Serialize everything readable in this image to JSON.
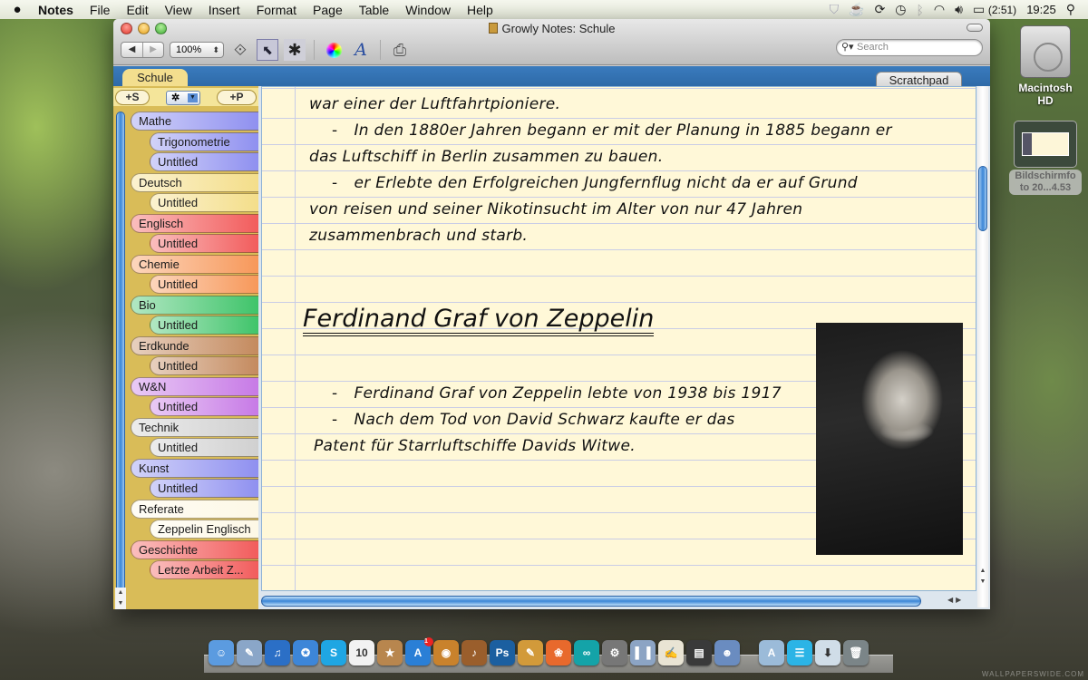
{
  "menubar": {
    "app_name": "Notes",
    "items": [
      "File",
      "Edit",
      "View",
      "Insert",
      "Format",
      "Page",
      "Table",
      "Window",
      "Help"
    ],
    "status_icons": [
      "shield-icon",
      "coffee-cup-icon",
      "sync-icon",
      "time-machine-icon",
      "bluetooth-icon",
      "wifi-icon",
      "volume-icon",
      "battery-icon"
    ],
    "battery_time": "(2:51)",
    "clock": "19:25"
  },
  "window": {
    "title": "Growly Notes: Schule",
    "zoom_value": "100%",
    "search_placeholder": "Search",
    "toolbar_icons": [
      "back-icon",
      "forward-icon",
      "insert-link-icon",
      "select-tool-icon",
      "asterisk-tool-icon",
      "color-wheel-icon",
      "font-icon",
      "print-icon"
    ]
  },
  "tabs": {
    "notebook": "Schule",
    "scratchpad": "Scratchpad"
  },
  "sidebar": {
    "add_section": "+S",
    "add_page": "+P",
    "sections": [
      {
        "label": "Mathe",
        "color": "#8f90f0",
        "pages": [
          "Trigonometrie",
          "Untitled"
        ]
      },
      {
        "label": "Deutsch",
        "color": "#f4de8a",
        "pages": [
          "Untitled"
        ]
      },
      {
        "label": "Englisch",
        "color": "#f25c5c",
        "pages": [
          "Untitled"
        ]
      },
      {
        "label": "Chemie",
        "color": "#f7985a",
        "pages": [
          "Untitled"
        ]
      },
      {
        "label": "Bio",
        "color": "#3fc46a",
        "pages": [
          "Untitled"
        ]
      },
      {
        "label": "Erdkunde",
        "color": "#c48a5e",
        "pages": [
          "Untitled"
        ]
      },
      {
        "label": "W&N",
        "color": "#c77ae6",
        "pages": [
          "Untitled"
        ]
      },
      {
        "label": "Technik",
        "color": "#d0d0d0",
        "pages": [
          "Untitled"
        ]
      },
      {
        "label": "Kunst",
        "color": "#8f90f0",
        "pages": [
          "Untitled"
        ]
      },
      {
        "label": "Referate",
        "color": "#fdf8e6",
        "pages": [
          "Zeppelin Englisch"
        ]
      },
      {
        "label": "Geschichte",
        "color": "#f25c5c",
        "pages": [
          "Letzte Arbeit Z..."
        ]
      }
    ]
  },
  "note": {
    "lines_top": [
      "war einer der Luftfahrtpioniere.",
      "In den 1880er Jahren begann er mit der Planung in 1885 begann er",
      "das Luftschiff in Berlin zusammen zu bauen.",
      "er Erlebte den Erfolgreichen Jungfernflug nicht da er auf Grund",
      "von reisen und seiner Nikotinsucht im Alter von nur 47 Jahren",
      "zusammenbrach und starb."
    ],
    "heading": "Ferdinand Graf von Zeppelin",
    "lines_bottom": [
      "Ferdinand Graf von Zeppelin lebte von 1938 bis 1917",
      "Nach dem Tod von David Schwarz kaufte er das",
      "Patent für Starrluftschiffe Davids Witwe."
    ],
    "bullet": "-",
    "image": "portrait-photo"
  },
  "desktop": {
    "hd_label": "Macintosh HD",
    "screenshot_label": "Bildschirmfo to 20...4.53"
  },
  "dock": {
    "items": [
      {
        "name": "finder",
        "glyph": "☺",
        "bg": "#5b9be0"
      },
      {
        "name": "preview",
        "glyph": "✎",
        "bg": "#8aa6c8"
      },
      {
        "name": "itunes",
        "glyph": "♫",
        "bg": "#2b6fc6"
      },
      {
        "name": "safari",
        "glyph": "✪",
        "bg": "#3d86d8"
      },
      {
        "name": "skype",
        "glyph": "S",
        "bg": "#1fa6e3"
      },
      {
        "name": "ical",
        "glyph": "10",
        "bg": "#f2f2f2"
      },
      {
        "name": "delicious-library",
        "glyph": "★",
        "bg": "#b8864e"
      },
      {
        "name": "app-store",
        "glyph": "A",
        "bg": "#2a7fd6",
        "badge": "1"
      },
      {
        "name": "photo-booth",
        "glyph": "◉",
        "bg": "#c9822c"
      },
      {
        "name": "garageband",
        "glyph": "♪",
        "bg": "#9a5e2c"
      },
      {
        "name": "photoshop",
        "glyph": "Ps",
        "bg": "#1b5fa0"
      },
      {
        "name": "pages",
        "glyph": "✎",
        "bg": "#d29a3a"
      },
      {
        "name": "iphoto",
        "glyph": "❀",
        "bg": "#e8692c"
      },
      {
        "name": "arduino",
        "glyph": "∞",
        "bg": "#14a3a8"
      },
      {
        "name": "system-preferences",
        "glyph": "⚙",
        "bg": "#777"
      },
      {
        "name": "split-view",
        "glyph": "▌▐",
        "bg": "#8ca4c4"
      },
      {
        "name": "textedit",
        "glyph": "✍",
        "bg": "#e9e4d4"
      },
      {
        "name": "growly-notes",
        "glyph": "▤",
        "bg": "#3a3a3a"
      },
      {
        "name": "iphoto-2",
        "glyph": "☻",
        "bg": "#6a8cc0"
      },
      {
        "name": "applications-folder",
        "glyph": "A",
        "bg": "#9bbbd9",
        "gap": true
      },
      {
        "name": "messages",
        "glyph": "☰",
        "bg": "#2bb4e6"
      },
      {
        "name": "downloads-stack",
        "glyph": "⬇",
        "bg": "#d0dde8"
      },
      {
        "name": "trash",
        "glyph": "🗑",
        "bg": "#7b8588"
      }
    ]
  }
}
